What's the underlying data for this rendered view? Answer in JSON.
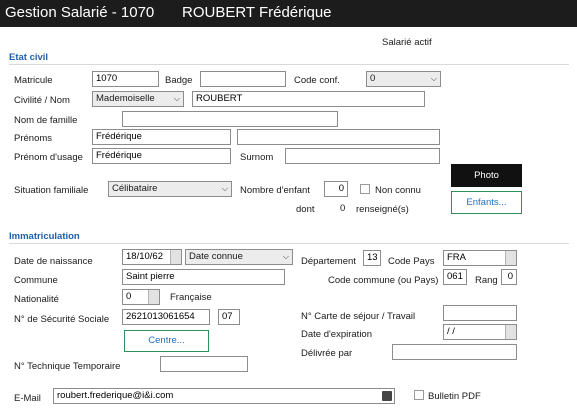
{
  "title": {
    "label": "Gestion Salarié - 1070",
    "name": "ROUBERT Frédérique"
  },
  "status": "Salarié actif",
  "etat_civil": {
    "section": "Etat civil",
    "matricule": {
      "label": "Matricule",
      "value": "1070"
    },
    "badge": {
      "label": "Badge",
      "value": ""
    },
    "code_conf": {
      "label": "Code conf.",
      "value": "0"
    },
    "civilite": {
      "label": "Civilité / Nom",
      "value": "Mademoiselle"
    },
    "nom": {
      "value": "ROUBERT"
    },
    "nom_famille": {
      "label": "Nom de famille",
      "value": ""
    },
    "prenoms": {
      "label": "Prénoms",
      "value": "Frédérique",
      "value2": ""
    },
    "prenom_usage": {
      "label": "Prénom d'usage",
      "value": "Frédérique"
    },
    "surnom": {
      "label": "Surnom",
      "value": ""
    },
    "situation": {
      "label": "Situation familiale",
      "value": "Célibataire"
    },
    "nb_enfant": {
      "label": "Nombre d'enfant",
      "value": "0"
    },
    "non_connu": "Non connu",
    "dont": "dont",
    "renseignes": {
      "value": "0",
      "label": "renseigné(s)"
    }
  },
  "buttons": {
    "photo": "Photo",
    "enfants": "Enfants...",
    "centre": "Centre..."
  },
  "immatriculation": {
    "section": "Immatriculation",
    "date_naissance": {
      "label": "Date de naissance",
      "value": "18/10/62",
      "mode": "Date connue"
    },
    "departement": {
      "label": "Département",
      "value": "13"
    },
    "code_pays": {
      "label": "Code Pays",
      "value": "FRA"
    },
    "commune": {
      "label": "Commune",
      "value": "Saint pierre"
    },
    "code_commune": {
      "label": "Code commune (ou Pays)",
      "value": "061"
    },
    "rang": {
      "label": "Rang",
      "value": "0"
    },
    "nationalite": {
      "label": "Nationalité",
      "code": "0",
      "value": "Française"
    },
    "secu": {
      "label": "N° de Sécurité Sociale",
      "value": "2621013061654",
      "key": "07"
    },
    "carte_sejour": {
      "label": "N° Carte de séjour / Travail",
      "value": ""
    },
    "date_expiration": {
      "label": "Date d'expiration",
      "value": " / /"
    },
    "delivree": {
      "label": "Délivrée par",
      "value": ""
    },
    "technique": {
      "label": "N° Technique Temporaire",
      "value": ""
    }
  },
  "email": {
    "label": "E-Mail",
    "value": "roubert.frederique@i&i.com"
  },
  "bulletin_pdf": "Bulletin PDF"
}
